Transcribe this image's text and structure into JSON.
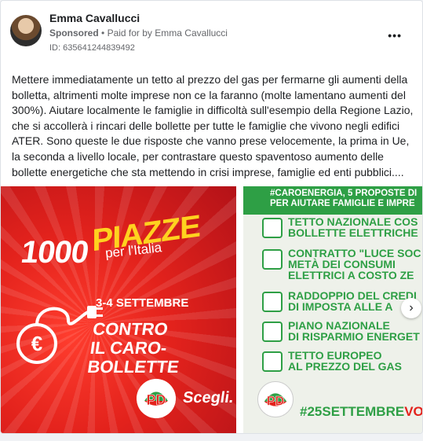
{
  "post": {
    "author": "Emma Cavallucci",
    "sponsored": "Sponsored",
    "paid_for": "Paid for by",
    "payer": "Emma Cavallucci",
    "id_label": "ID: 635641244839492",
    "more": "•••",
    "text": "Mettere immediatamente un tetto al prezzo del gas per fermarne gli aumenti della bolletta, altrimenti molte imprese non ce la faranno (molte lamentano aumenti del 300%). Aiutare localmente le famiglie in difficoltà sull'esempio della Regione Lazio, che si accollerà i rincari delle bollette per tutte le famiglie che vivono negli edifici ATER. Sono queste le due risposte che vanno prese velocemente, la prima in Ue, la seconda a livello locale, per contrastare questo spaventoso aumento delle bollette energetiche che sta mettendo in crisi imprese, famiglie ed enti pubblici...."
  },
  "slide1": {
    "big": "1000",
    "piazze": "PIAZZE",
    "sub": "per l'Italia",
    "date": "3-4 SETTEMBRE",
    "line1": "CONTRO",
    "line2": "IL CARO-BOLLETTE",
    "pd": "PD",
    "cta": "Scegli."
  },
  "slide2": {
    "title1": "#CAROENERGIA, 5 PROPOSTE DI",
    "title2": "PER AIUTARE FAMIGLIE E IMPRE",
    "items": [
      {
        "l1": "TETTO NAZIONALE COS",
        "l2": "BOLLETTE ELETTRICHE"
      },
      {
        "l1": "CONTRATTO \"LUCE SOC",
        "l2": "METÀ DEI CONSUMI",
        "l3": "ELETTRICI A COSTO ZE"
      },
      {
        "l1": "RADDOPPIO DEL CREDI",
        "l2": "DI IMPOSTA ALLE A"
      },
      {
        "l1": "PIANO NAZIONALE",
        "l2": "DI RISPARMIO ENERGET"
      },
      {
        "l1": "TETTO EUROPEO",
        "l2": "AL PREZZO DEL GAS"
      }
    ],
    "hashtag": "#25SETTEMBRE",
    "hashtag_tail": "VO",
    "pd": "PD"
  },
  "carousel": {
    "next": "›"
  }
}
